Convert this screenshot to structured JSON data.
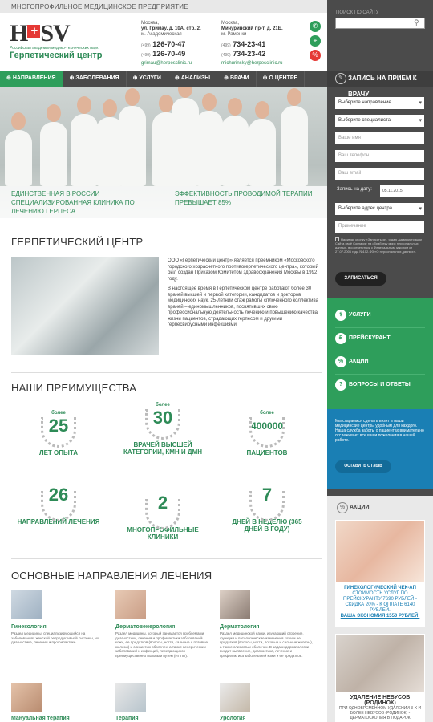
{
  "topbar": {
    "text": "Многопрофильное медицинское предприятие"
  },
  "logo": {
    "mark_left": "H",
    "mark_cross": "+",
    "mark_right": "SV",
    "subtitle": "Российская академия медико-технических наук",
    "title": "Герпетический центр"
  },
  "contacts": [
    {
      "city": "Москва,",
      "street": "ул. Гримау, д. 10А, стр. 2,",
      "metro": "м. Академическая",
      "phone1_code": "(499)",
      "phone1": "126-70-47",
      "phone2_code": "(499)",
      "phone2": "126-70-49",
      "email": "grimau@herpesclinic.ru"
    },
    {
      "city": "Москва,",
      "street": "Мичуринский пр-т, д. 21Б,",
      "metro": "м. Раменки",
      "phone1_code": "(499)",
      "phone1": "734-23-41",
      "phone2_code": "(499)",
      "phone2": "734-23-42",
      "email": "michurinsky@herpesclinic.ru"
    }
  ],
  "nav": [
    "Направления",
    "Заболевания",
    "Услуги",
    "Анализы",
    "Врачи",
    "О центре"
  ],
  "hero": {
    "caption_left": "Единственная в России специализированная клиника по лечению герпеса.",
    "caption_right": "Эффективность проводимой терапии превышает 85%"
  },
  "search": {
    "label": "Поиск по сайту",
    "placeholder": ""
  },
  "appointment": {
    "title": "Запись на прием к врачу",
    "direction": "Выберите направление",
    "specialist": "Выберите специалиста",
    "name": "Ваше имя",
    "phone": "Ваш телефон",
    "email": "Ваш email",
    "date_label": "Запись на дату:",
    "date_value": "05.11.2015",
    "clinic": "Выберите адрес центра",
    "note": "Примечание",
    "consent": "Нажимая кнопку «Записаться», я даю Администрации Сайта своё Согласие на обработку моих персональных данных, в соответствии с Федеральным законом от 27.07.2006 года №152-ФЗ «О персональных данных».",
    "submit": "Записаться"
  },
  "green_menu": [
    "Услуги",
    "Прейскурант",
    "Акции",
    "Вопросы и ответы"
  ],
  "feedback": {
    "text": "Мы стараемся сделать визит в наши медицинские центры удобным для каждого. Наша служба заботы о пациентах внимательно отслеживает все ваши пожелания в нашей работе.",
    "button": "Оставить отзыв"
  },
  "promo": {
    "title": "Акции",
    "card1": {
      "line1": "Гинекологический чек-ап",
      "line2": "стоимость услуг по прейскуранту 7690 рублей - скидка 20% - к оплате 6140 рублей.",
      "line3": "Ваша экономия 1550 рублей!"
    },
    "card2": {
      "title": "Удаление невусов (родинок)",
      "text": "при одновременном удалении 3-х и более невусов (родинок) - дерматоскопия в подарок"
    }
  },
  "about": {
    "title": "Герпетический центр",
    "p1": "ООО «Герпетический центр» является преемником «Московского городского хозрасчетного противогерпетического центра», который был создан Приказом Комитетом здравоохранения Москвы в 1992 году.",
    "p2": "В настоящее время в Герпетическом центре работают более 30 врачей высшей и первой категории, кандидатов и докторов медицинских наук. 25-летний стаж работы сплоченного коллектива врачей – единомышленников, посвятивших свою профессиональную деятельность лечению и повышению качества жизни пациентов, страдающих герпесом и другими герпесвирусными инфекциями."
  },
  "advantages": {
    "title": "Наши преимущества",
    "items": [
      {
        "pre": "более",
        "num": "25",
        "cap": "лет опыта"
      },
      {
        "pre": "более",
        "num": "30",
        "cap": "врачей высшей категории, кмн и дмн"
      },
      {
        "pre": "более",
        "num": "400000",
        "cap": "пациентов"
      },
      {
        "pre": "",
        "num": "26",
        "cap": "направлений лечения"
      },
      {
        "pre": "",
        "num": "2",
        "cap": "многопрофильные клиники"
      },
      {
        "pre": "",
        "num": "7",
        "cap": "дней в неделю (365 дней в году)"
      }
    ]
  },
  "directions": {
    "title": "Основные направления лечения",
    "items": [
      {
        "name": "Гинекология",
        "desc": "Раздел медицины, специализирующийся на заболеваниях женской репродуктивной системы, их диагностике, лечении и профилактике."
      },
      {
        "name": "Дерматовенерология",
        "desc": "Раздел медицины, который занимается проблемами диагностики, лечения и профилактики заболеваний кожи, ее придатков (волосы, ногти, сальные и потовые железы) и слизистых оболочек, а также венерических заболеваний и инфекций, передающихся преимущественно половым путем (ИППП)."
      },
      {
        "name": "Дерматология",
        "desc": "Раздел медицинской науки, изучающий строение, функции и патологические изменения кожи и ее придатков (волосы, ногти, потовые и сальные железы), а также слизистых оболочек. В задачи дерматологии входит выявление, диагностика, лечение и профилактика заболеваний кожи и ее придатков."
      },
      {
        "name": "Мануальная терапия",
        "desc": ""
      },
      {
        "name": "Терапия",
        "desc": ""
      },
      {
        "name": "Урология",
        "desc": ""
      }
    ]
  }
}
